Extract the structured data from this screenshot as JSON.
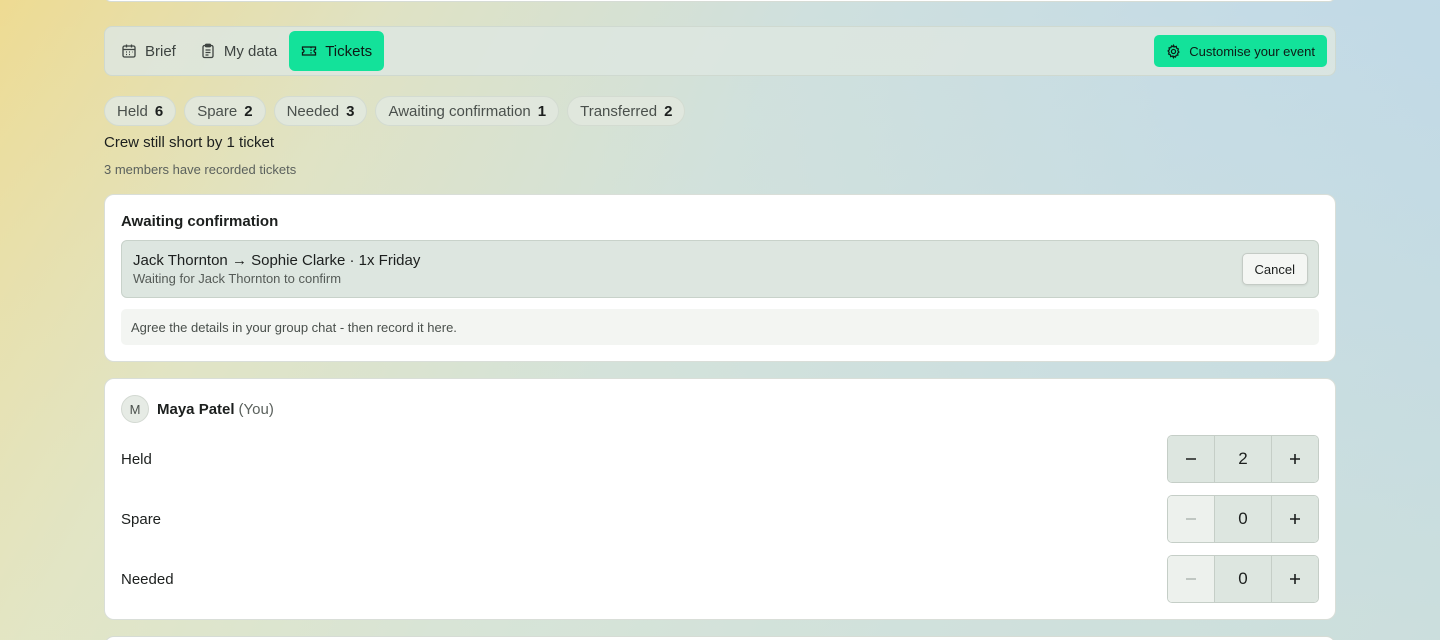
{
  "tabs": [
    {
      "label": "Brief",
      "icon": "calendar-icon",
      "active": false
    },
    {
      "label": "My data",
      "icon": "clipboard-icon",
      "active": false
    },
    {
      "label": "Tickets",
      "icon": "ticket-icon",
      "active": true
    }
  ],
  "customise_label": "Customise your event",
  "pills": [
    {
      "label": "Held",
      "count": "6"
    },
    {
      "label": "Spare",
      "count": "2"
    },
    {
      "label": "Needed",
      "count": "3"
    },
    {
      "label": "Awaiting confirmation",
      "count": "1"
    },
    {
      "label": "Transferred",
      "count": "2"
    }
  ],
  "shortfall": "Crew still short by 1 ticket",
  "members_note": "3 members have recorded tickets",
  "awaiting": {
    "heading": "Awaiting confirmation",
    "transfer_title": "Jack Thornton → Sophie Clarke · 1x Friday",
    "transfer_sub": "Waiting for Jack Thornton to confirm",
    "cancel_label": "Cancel",
    "hint": "Agree the details in your group chat - then record it here."
  },
  "member": {
    "initial": "M",
    "name": "Maya Patel",
    "you_label": "(You)",
    "rows": [
      {
        "label": "Held",
        "value": "2",
        "minus_enabled": true
      },
      {
        "label": "Spare",
        "value": "0",
        "minus_enabled": false
      },
      {
        "label": "Needed",
        "value": "0",
        "minus_enabled": false
      }
    ]
  },
  "colors": {
    "accent": "#13e29a"
  }
}
